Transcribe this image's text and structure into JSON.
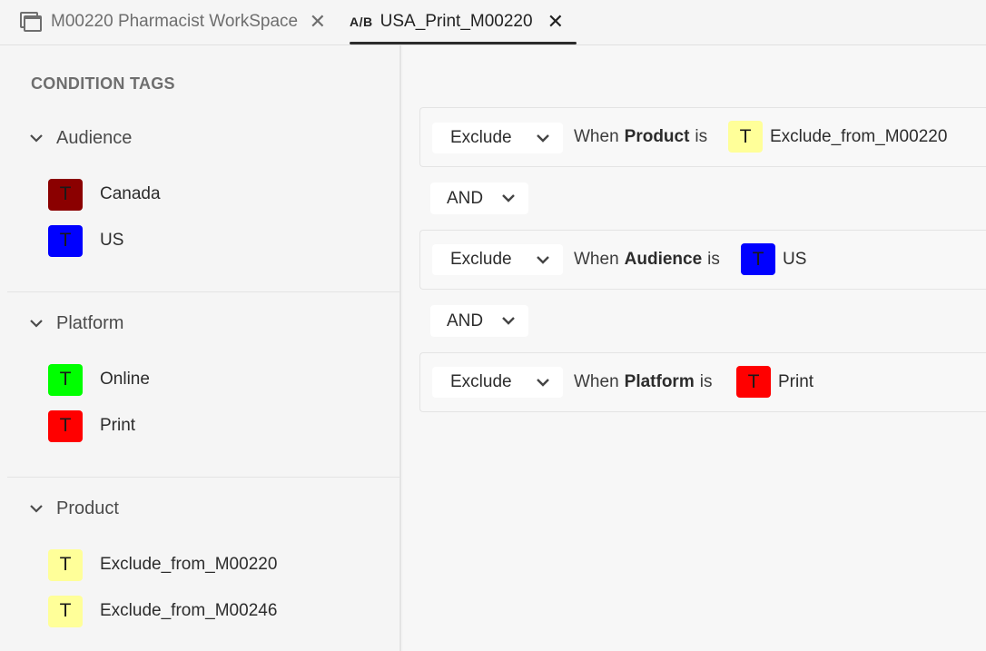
{
  "tabs": [
    {
      "label": "M00220 Pharmacist WorkSpace",
      "icon": "workspace-icon",
      "active": false
    },
    {
      "label": "USA_Print_M00220",
      "icon_text": "A/B",
      "active": true
    }
  ],
  "tab_close_glyph": "✕",
  "sidebar": {
    "title": "CONDITION TAGS",
    "groups": [
      {
        "label": "Audience",
        "tags": [
          {
            "label": "Canada",
            "letter": "T",
            "color": "#8b0000"
          },
          {
            "label": "US",
            "letter": "T",
            "color": "#0000ff"
          }
        ]
      },
      {
        "label": "Platform",
        "tags": [
          {
            "label": "Online",
            "letter": "T",
            "color": "#00ff00"
          },
          {
            "label": "Print",
            "letter": "T",
            "color": "#ff0000"
          }
        ]
      },
      {
        "label": "Product",
        "tags": [
          {
            "label": "Exclude_from_M00220",
            "letter": "T",
            "color": "#ffff99"
          },
          {
            "label": "Exclude_from_M00246",
            "letter": "T",
            "color": "#ffff99"
          }
        ]
      }
    ]
  },
  "conditions": [
    {
      "action": "Exclude",
      "when": "When",
      "category": "Product",
      "is": "is",
      "tag": {
        "label": "Exclude_from_M00220",
        "letter": "T",
        "color": "#ffff99"
      }
    },
    {
      "action": "Exclude",
      "when": "When",
      "category": "Audience",
      "is": "is",
      "tag": {
        "label": "US",
        "letter": "T",
        "color": "#0000ff"
      }
    },
    {
      "action": "Exclude",
      "when": "When",
      "category": "Platform",
      "is": "is",
      "tag": {
        "label": "Print",
        "letter": "T",
        "color": "#ff0000"
      }
    }
  ],
  "operators": [
    "AND",
    "AND"
  ]
}
